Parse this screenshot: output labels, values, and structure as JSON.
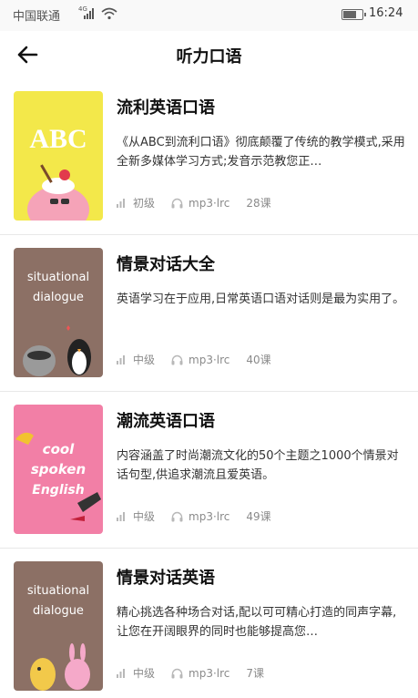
{
  "status_bar": {
    "carrier": "中国联通",
    "network": "4G",
    "time": "16:24"
  },
  "nav": {
    "title": "听力口语"
  },
  "courses": [
    {
      "title": "流利英语口语",
      "description": "《从ABC到流利口语》彻底颠覆了传统的教学模式,采用全新多媒体学习方式;发音示范教您正…",
      "level": "初级",
      "format": "mp3·lrc",
      "lessons": "28课",
      "cover_text": "ABC",
      "cover_color": "#f3e84a"
    },
    {
      "title": "情景对话大全",
      "description": "英语学习在于应用,日常英语口语对话则是最为实用了。",
      "level": "中级",
      "format": "mp3·lrc",
      "lessons": "40课",
      "cover_text": "situational dialogue",
      "cover_color": "#8c7065"
    },
    {
      "title": "潮流英语口语",
      "description": "内容涵盖了时尚潮流文化的50个主题之1000个情景对话句型,供追求潮流且爱英语。",
      "level": "中级",
      "format": "mp3·lrc",
      "lessons": "49课",
      "cover_text": "cool spoken English",
      "cover_color": "#f27fa6"
    },
    {
      "title": "情景对话英语",
      "description": "精心挑选各种场合对话,配以可可精心打造的同声字幕,让您在开阔眼界的同时也能够提高您…",
      "level": "中级",
      "format": "mp3·lrc",
      "lessons": "7课",
      "cover_text": "situational dialogue",
      "cover_color": "#8c7065"
    }
  ]
}
